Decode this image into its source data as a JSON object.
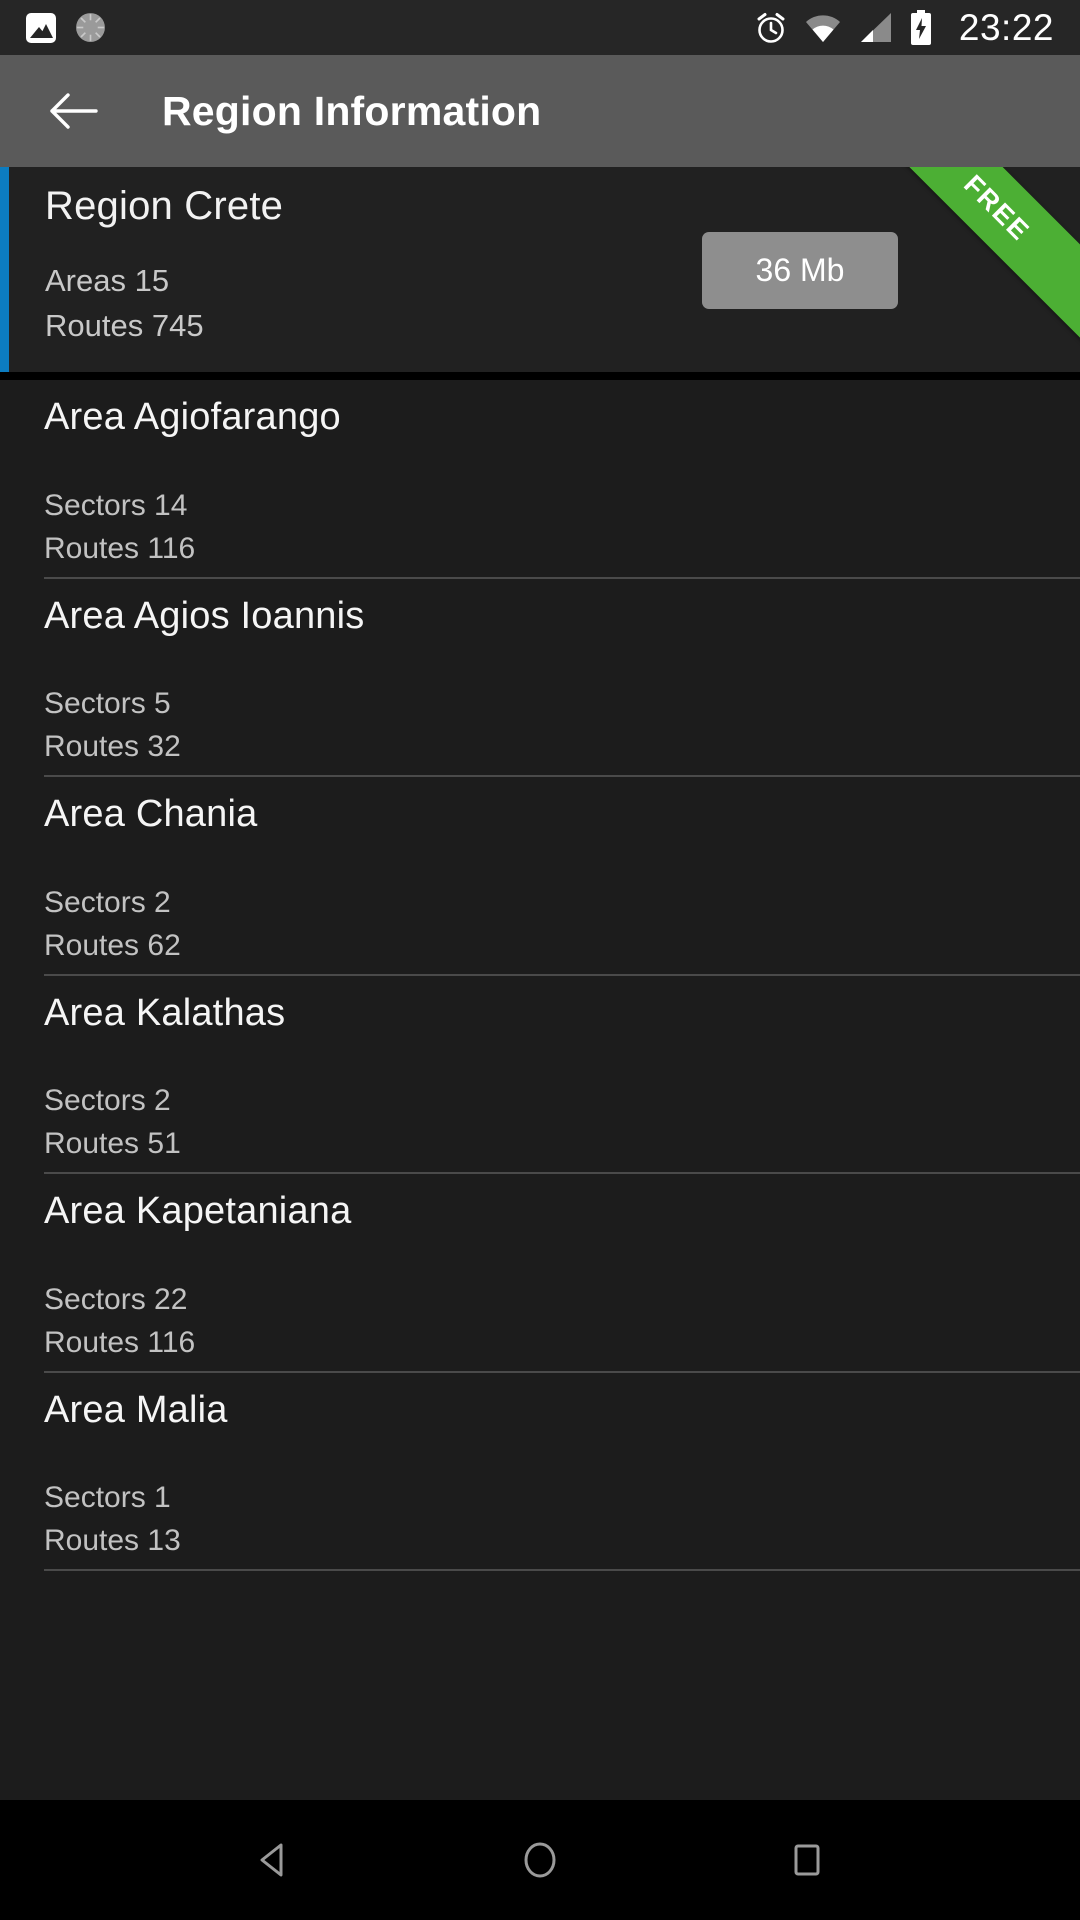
{
  "status_bar": {
    "time": "23:22",
    "left_icons": [
      {
        "name": "photo-icon",
        "label": "Photo"
      },
      {
        "name": "sync-progress-icon",
        "label": "Sync"
      }
    ],
    "right_icons": [
      {
        "name": "alarm-icon",
        "label": "Alarm set"
      },
      {
        "name": "wifi-icon",
        "label": "Wi-Fi"
      },
      {
        "name": "cellular-signal-icon",
        "label": "Cellular signal"
      },
      {
        "name": "battery-charging-icon",
        "label": "Battery charging"
      }
    ]
  },
  "action_bar": {
    "title": "Region Information",
    "back_icon": "arrow-left-icon"
  },
  "region": {
    "name": "Region Crete",
    "areas_label": "Areas 15",
    "routes_label": "Routes 745",
    "size_label": "36 Mb",
    "ribbon_label": "FREE",
    "accent_color": "#0c7cc0",
    "ribbon_color": "#4caf34",
    "size_button_color": "#8e8e8e"
  },
  "areas": [
    {
      "name": "Area Agiofarango",
      "sectors": "Sectors 14",
      "routes": "Routes 116"
    },
    {
      "name": "Area Agios Ioannis",
      "sectors": "Sectors 5",
      "routes": "Routes 32"
    },
    {
      "name": "Area Chania",
      "sectors": "Sectors 2",
      "routes": "Routes 62"
    },
    {
      "name": "Area Kalathas",
      "sectors": "Sectors 2",
      "routes": "Routes 51"
    },
    {
      "name": "Area Kapetaniana",
      "sectors": "Sectors 22",
      "routes": "Routes 116"
    },
    {
      "name": "Area Malia",
      "sectors": "Sectors 1",
      "routes": "Routes 13"
    }
  ],
  "nav_bar": {
    "back": "back-nav-icon",
    "home": "home-nav-icon",
    "recents": "recents-nav-icon"
  }
}
